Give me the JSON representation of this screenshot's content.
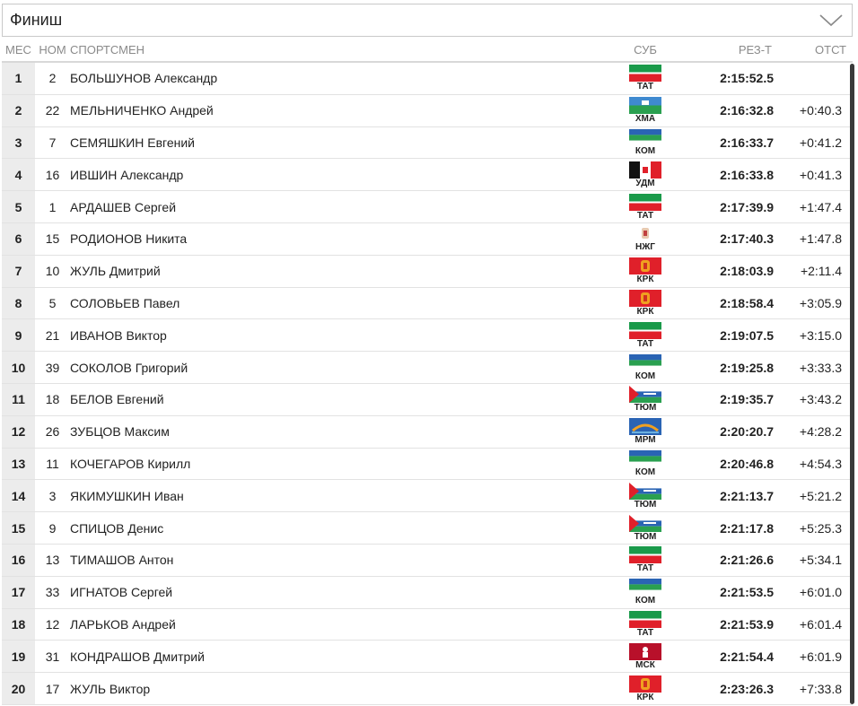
{
  "dropdown": {
    "label": "Финиш"
  },
  "headers": {
    "pos": "МЕС",
    "num": "НОМ",
    "name": "СПОРТСМЕН",
    "sub": "СУБ",
    "result": "РЕЗ-Т",
    "gap": "ОТСТ"
  },
  "rows": [
    {
      "pos": "1",
      "num": "2",
      "name": "БОЛЬШУНОВ Александр",
      "region": "ТАТ",
      "flag": "tat",
      "result": "2:15:52.5",
      "gap": ""
    },
    {
      "pos": "2",
      "num": "22",
      "name": "МЕЛЬНИЧЕНКО Андрей",
      "region": "ХМА",
      "flag": "hma",
      "result": "2:16:32.8",
      "gap": "+0:40.3"
    },
    {
      "pos": "3",
      "num": "7",
      "name": "СЕМЯШКИН Евгений",
      "region": "КОМ",
      "flag": "kom",
      "result": "2:16:33.7",
      "gap": "+0:41.2"
    },
    {
      "pos": "4",
      "num": "16",
      "name": "ИВШИН Александр",
      "region": "УДМ",
      "flag": "udm",
      "result": "2:16:33.8",
      "gap": "+0:41.3"
    },
    {
      "pos": "5",
      "num": "1",
      "name": "АРДАШЕВ Сергей",
      "region": "ТАТ",
      "flag": "tat",
      "result": "2:17:39.9",
      "gap": "+1:47.4"
    },
    {
      "pos": "6",
      "num": "15",
      "name": "РОДИОНОВ Никита",
      "region": "НЖГ",
      "flag": "nzg",
      "result": "2:17:40.3",
      "gap": "+1:47.8"
    },
    {
      "pos": "7",
      "num": "10",
      "name": "ЖУЛЬ Дмитрий",
      "region": "КРК",
      "flag": "krk",
      "result": "2:18:03.9",
      "gap": "+2:11.4"
    },
    {
      "pos": "8",
      "num": "5",
      "name": "СОЛОВЬЕВ Павел",
      "region": "КРК",
      "flag": "krk",
      "result": "2:18:58.4",
      "gap": "+3:05.9"
    },
    {
      "pos": "9",
      "num": "21",
      "name": "ИВАНОВ Виктор",
      "region": "ТАТ",
      "flag": "tat",
      "result": "2:19:07.5",
      "gap": "+3:15.0"
    },
    {
      "pos": "10",
      "num": "39",
      "name": "СОКОЛОВ Григорий",
      "region": "КОМ",
      "flag": "kom",
      "result": "2:19:25.8",
      "gap": "+3:33.3"
    },
    {
      "pos": "11",
      "num": "18",
      "name": "БЕЛОВ Евгений",
      "region": "ТЮМ",
      "flag": "tum",
      "result": "2:19:35.7",
      "gap": "+3:43.2"
    },
    {
      "pos": "12",
      "num": "26",
      "name": "ЗУБЦОВ Максим",
      "region": "МРМ",
      "flag": "mrm",
      "result": "2:20:20.7",
      "gap": "+4:28.2"
    },
    {
      "pos": "13",
      "num": "11",
      "name": "КОЧЕГАРОВ Кирилл",
      "region": "КОМ",
      "flag": "kom",
      "result": "2:20:46.8",
      "gap": "+4:54.3"
    },
    {
      "pos": "14",
      "num": "3",
      "name": "ЯКИМУШКИН Иван",
      "region": "ТЮМ",
      "flag": "tum",
      "result": "2:21:13.7",
      "gap": "+5:21.2"
    },
    {
      "pos": "15",
      "num": "9",
      "name": "СПИЦОВ Денис",
      "region": "ТЮМ",
      "flag": "tum",
      "result": "2:21:17.8",
      "gap": "+5:25.3"
    },
    {
      "pos": "16",
      "num": "13",
      "name": "ТИМАШОВ Антон",
      "region": "ТАТ",
      "flag": "tat",
      "result": "2:21:26.6",
      "gap": "+5:34.1"
    },
    {
      "pos": "17",
      "num": "33",
      "name": "ИГНАТОВ Сергей",
      "region": "КОМ",
      "flag": "kom",
      "result": "2:21:53.5",
      "gap": "+6:01.0"
    },
    {
      "pos": "18",
      "num": "12",
      "name": "ЛАРЬКОВ Андрей",
      "region": "ТАТ",
      "flag": "tat",
      "result": "2:21:53.9",
      "gap": "+6:01.4"
    },
    {
      "pos": "19",
      "num": "31",
      "name": "КОНДРАШОВ Дмитрий",
      "region": "МСК",
      "flag": "msk",
      "result": "2:21:54.4",
      "gap": "+6:01.9"
    },
    {
      "pos": "20",
      "num": "17",
      "name": "ЖУЛЬ Виктор",
      "region": "КРК",
      "flag": "krk",
      "result": "2:23:26.3",
      "gap": "+7:33.8"
    }
  ]
}
